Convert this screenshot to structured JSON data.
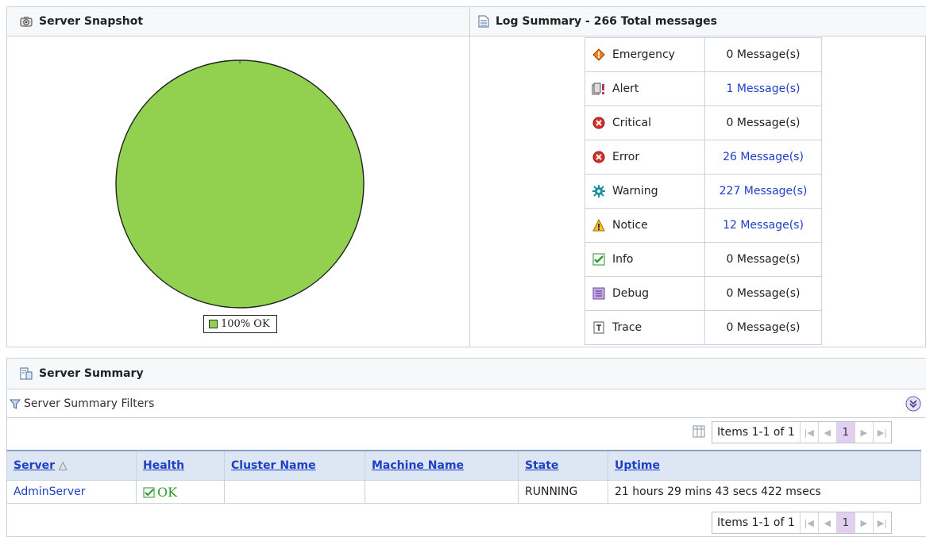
{
  "snapshot": {
    "title": "Server Snapshot",
    "legend": "100% OK"
  },
  "chart_data": {
    "type": "pie",
    "categories": [
      "OK"
    ],
    "values": [
      100
    ],
    "colors": [
      "#92d050"
    ],
    "legend": [
      "100% OK"
    ]
  },
  "log": {
    "title": "Log Summary - 266 Total messages",
    "rows": [
      {
        "level": "Emergency",
        "count": "0 Message(s)",
        "link": false,
        "icon": "emergency-icon"
      },
      {
        "level": "Alert",
        "count": "1 Message(s)",
        "link": true,
        "icon": "alert-icon"
      },
      {
        "level": "Critical",
        "count": "0 Message(s)",
        "link": false,
        "icon": "critical-icon"
      },
      {
        "level": "Error",
        "count": "26 Message(s)",
        "link": true,
        "icon": "error-icon"
      },
      {
        "level": "Warning",
        "count": "227 Message(s)",
        "link": true,
        "icon": "warning-icon"
      },
      {
        "level": "Notice",
        "count": "12 Message(s)",
        "link": true,
        "icon": "notice-icon"
      },
      {
        "level": "Info",
        "count": "0 Message(s)",
        "link": false,
        "icon": "info-icon"
      },
      {
        "level": "Debug",
        "count": "0 Message(s)",
        "link": false,
        "icon": "debug-icon"
      },
      {
        "level": "Trace",
        "count": "0 Message(s)",
        "link": false,
        "icon": "trace-icon"
      }
    ]
  },
  "summary": {
    "title": "Server Summary",
    "filters_label": "Server Summary Filters",
    "pager_text": "Items 1-1 of 1",
    "page": "1",
    "columns": [
      "Server",
      "Health",
      "Cluster Name",
      "Machine Name",
      "State",
      "Uptime"
    ],
    "rows": [
      {
        "server": "AdminServer",
        "health": "OK",
        "cluster": "",
        "machine": "",
        "state": "RUNNING",
        "uptime": "21 hours 29 mins 43 secs 422 msecs"
      }
    ]
  }
}
